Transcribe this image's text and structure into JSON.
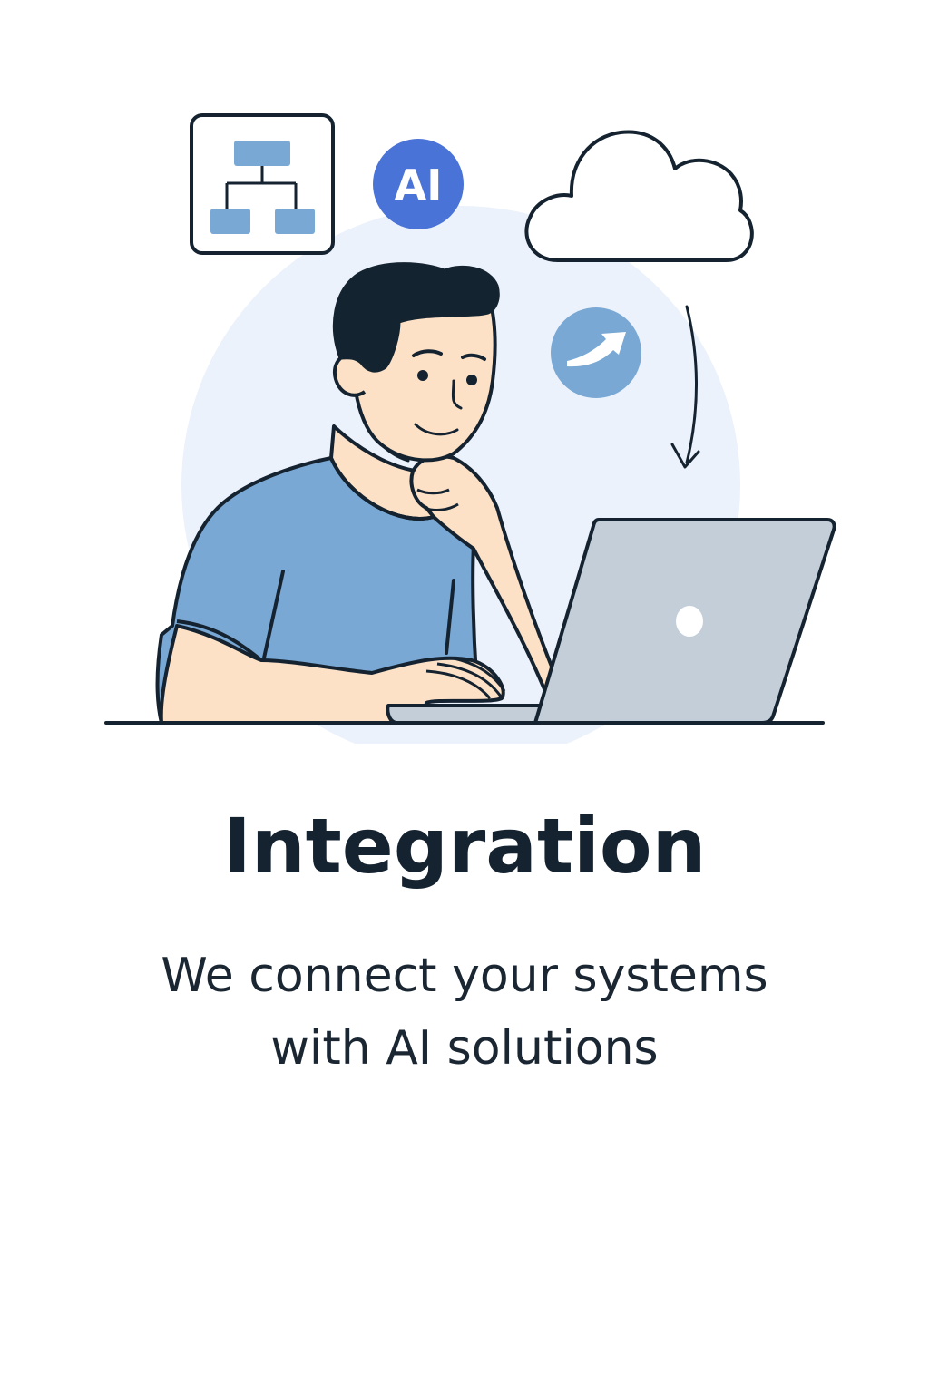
{
  "title": "Integration",
  "subtitle": {
    "line1": "We connect your systems",
    "line2": "with AI solutions"
  },
  "badges": {
    "ai_label": "AI"
  },
  "icons": {
    "workflow": "org-chart-icon",
    "ai": "ai-badge-icon",
    "cloud": "cloud-icon",
    "share": "share-arrow-icon",
    "flow_arrow": "curved-arrow-down-icon",
    "laptop": "laptop-icon"
  },
  "colors": {
    "text": "#152331",
    "ai_badge": "#4a73d8",
    "accent_blue": "#79a8d4",
    "background_circle": "#ebf2fb",
    "skin": "#fce1c6",
    "hair": "#142330",
    "laptop": "#c3ced9"
  }
}
